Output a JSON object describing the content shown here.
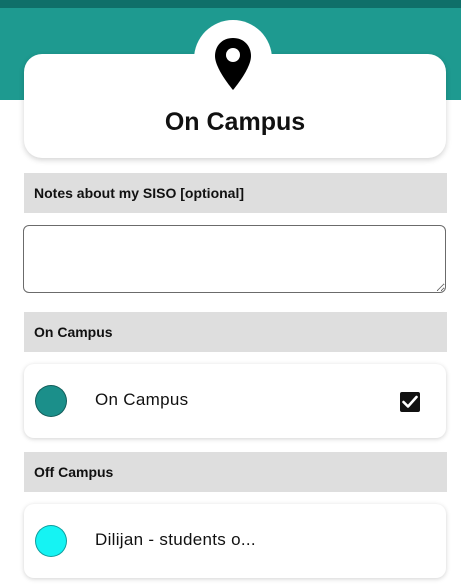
{
  "header": {
    "title": "On Campus",
    "icon": "map-pin-icon",
    "band_color": "#1e9a90"
  },
  "notes": {
    "label": "Notes about my SISO [optional]",
    "value": "",
    "placeholder": ""
  },
  "sections": [
    {
      "title": "On Campus",
      "items": [
        {
          "label": "On Campus",
          "color": "#1b8f8a",
          "checked": true
        }
      ]
    },
    {
      "title": "Off Campus",
      "items": [
        {
          "label": "Dilijan - students o...",
          "color": "#15f3f3",
          "checked": false
        }
      ]
    }
  ]
}
